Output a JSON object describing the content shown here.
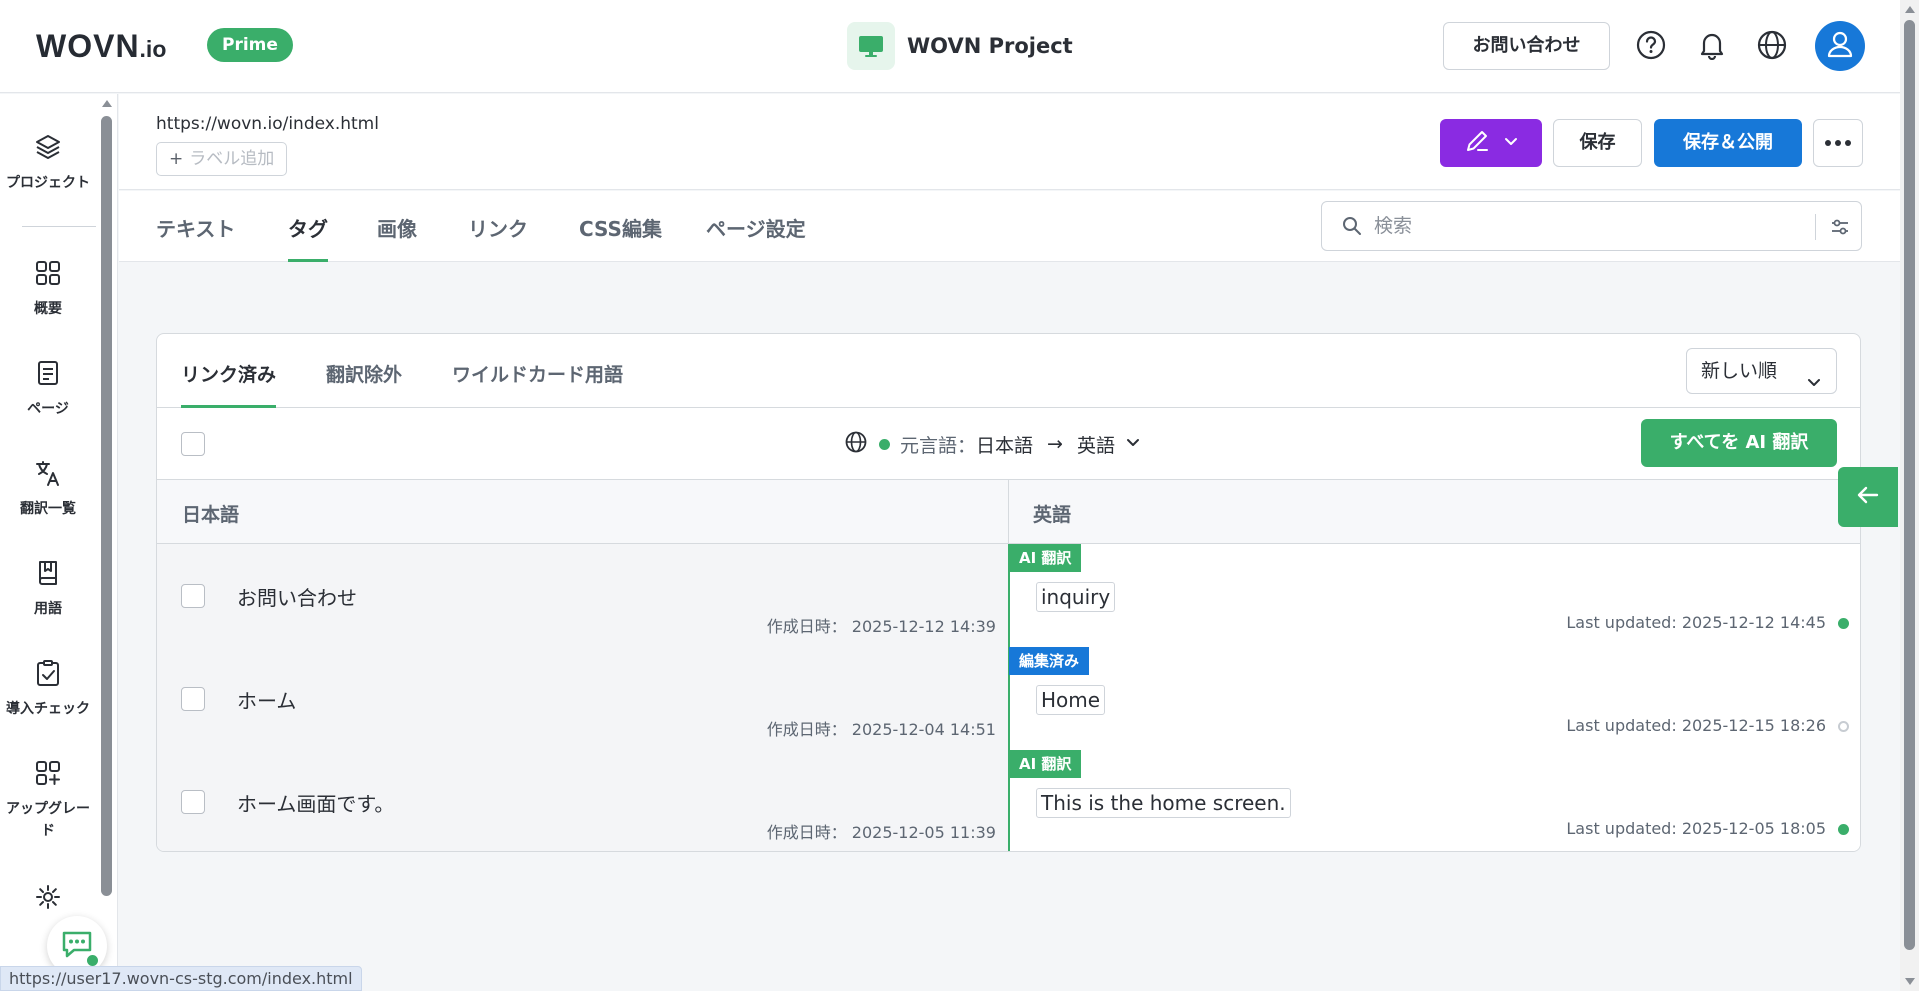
{
  "header": {
    "logo": "WOVN",
    "logo_suffix": ".io",
    "plan_badge": "Prime",
    "project_name": "WOVN Project",
    "contact_button": "お問い合わせ",
    "icons": [
      "help-icon",
      "bell-icon",
      "globe-icon",
      "user-icon"
    ]
  },
  "sidebar": {
    "items": [
      {
        "label": "プロジェクト",
        "icon": "layers-icon"
      },
      {
        "label": "概要",
        "icon": "grid-icon"
      },
      {
        "label": "ページ",
        "icon": "document-icon"
      },
      {
        "label": "翻訳一覧",
        "icon": "translate-icon"
      },
      {
        "label": "用語",
        "icon": "book-icon"
      },
      {
        "label": "導入チェック",
        "icon": "clipboard-check-icon"
      },
      {
        "label": "アップグレード",
        "icon": "grid-plus-icon"
      },
      {
        "label": "",
        "icon": "gear-icon"
      }
    ]
  },
  "page": {
    "url": "https://wovn.io/index.html",
    "add_label": "ラベル追加",
    "save_button": "保存",
    "publish_button": "保存＆公開"
  },
  "tabs": [
    "テキスト",
    "タグ",
    "画像",
    "リンク",
    "CSS編集",
    "ページ設定"
  ],
  "active_tab": "タグ",
  "search": {
    "placeholder": "検索",
    "value": ""
  },
  "subtabs": [
    "リンク済み",
    "翻訳除外",
    "ワイルドカード用語"
  ],
  "active_subtab": "リンク済み",
  "sort": {
    "selected": "新しい順"
  },
  "language": {
    "source_label": "元言語：",
    "source": "日本語",
    "arrow": "→",
    "target": "英語"
  },
  "ai_translate_button": "すべてを AI 翻訳",
  "columns": {
    "source": "日本語",
    "target": "英語"
  },
  "rows": [
    {
      "source": "お問い合わせ",
      "created": "作成日時： 2025-12-12 14:39",
      "badge": "AI 翻訳",
      "badge_type": "ai",
      "target": "inquiry",
      "updated": "Last updated: 2025-12-12 14:45",
      "status": "published"
    },
    {
      "source": "ホーム",
      "created": "作成日時： 2025-12-04 14:51",
      "badge": "編集済み",
      "badge_type": "edited",
      "target": "Home",
      "updated": "Last updated: 2025-12-15 18:26",
      "status": "unpublished"
    },
    {
      "source": "ホーム画面です。",
      "created": "作成日時： 2025-12-05 11:39",
      "badge": "AI 翻訳",
      "badge_type": "ai",
      "target": "This is the home screen.",
      "updated": "Last updated: 2025-12-05 18:05",
      "status": "published"
    }
  ],
  "status_bar": "https://user17.wovn-cs-stg.com/index.html",
  "colors": {
    "green": "#3aae6a",
    "blue": "#1778d8",
    "purple": "#8a2be2"
  }
}
